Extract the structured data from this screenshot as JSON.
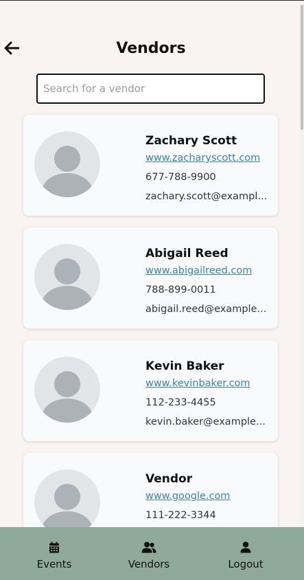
{
  "header": {
    "title": "Vendors",
    "back_icon": "arrow-left-icon"
  },
  "search": {
    "placeholder": "Search for a vendor",
    "value": ""
  },
  "vendors": [
    {
      "name": "Zachary Scott",
      "website": "www.zacharyscott.com",
      "phone": "677-788-9900",
      "email": "zachary.scott@exampl..."
    },
    {
      "name": "Abigail Reed",
      "website": "www.abigailreed.com",
      "phone": "788-899-0011",
      "email": "abigail.reed@example..."
    },
    {
      "name": "Kevin Baker",
      "website": "www.kevinbaker.com",
      "phone": "112-233-4455",
      "email": "kevin.baker@example..."
    },
    {
      "name": "Vendor",
      "website": "www.google.com",
      "phone": "111-222-3344",
      "email": ""
    }
  ],
  "bottom_nav": {
    "items": [
      {
        "label": "Events",
        "icon": "calendar-icon"
      },
      {
        "label": "Vendors",
        "icon": "users-icon"
      },
      {
        "label": "Logout",
        "icon": "user-icon"
      }
    ]
  },
  "colors": {
    "background": "#f9f4f1",
    "card": "#f8fafc",
    "link": "#3b82b4",
    "nav_bar": "#8faa9b",
    "avatar_bg": "#e2e4e8",
    "avatar_fg": "#adb2b8"
  }
}
